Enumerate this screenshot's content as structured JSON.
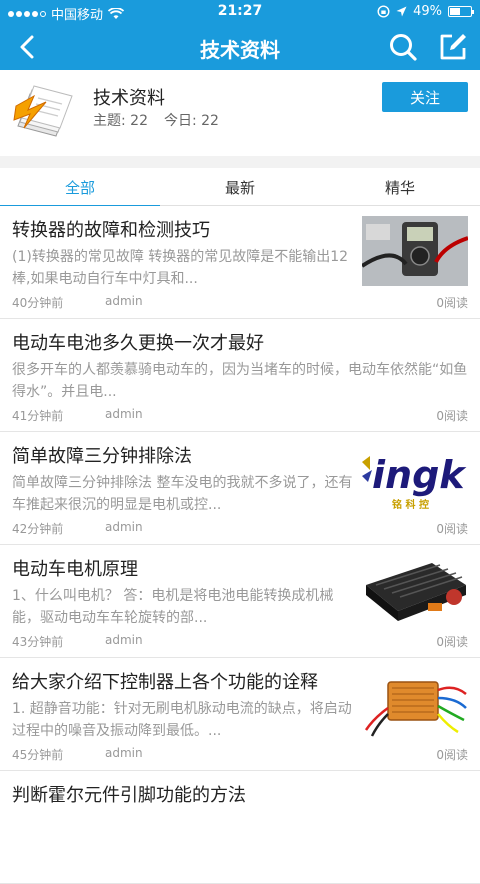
{
  "status": {
    "carrier": "中国移动",
    "time": "21:27",
    "battery": "49%"
  },
  "nav": {
    "title": "技术资料"
  },
  "forum": {
    "name": "技术资料",
    "topics_label": "主题: 22",
    "today_label": "今日: 22",
    "follow_label": "关注"
  },
  "tabs": [
    {
      "label": "全部",
      "active": true
    },
    {
      "label": "最新",
      "active": false
    },
    {
      "label": "精华",
      "active": false
    }
  ],
  "articles": [
    {
      "title": "转换器的故障和检测技巧",
      "summary": "(1)转换器的常见故障 转换器的常见故障是不能输出12棒,如果电动自行车中灯具和...",
      "time": "40分钟前",
      "author": "admin",
      "reads": "0阅读",
      "thumb": "multimeter-photo"
    },
    {
      "title": "电动车电池多久更换一次才最好",
      "summary": "很多开车的人都羡慕骑电动车的，因为当堵车的时候，电动车依然能“如鱼得水”。并且电...",
      "time": "41分钟前",
      "author": "admin",
      "reads": "0阅读",
      "thumb": ""
    },
    {
      "title": "简单故障三分钟排除法",
      "summary": "简单故障三分钟排除法  整车没电的我就不多说了，还有车推起来很沉的明显是电机或控...",
      "time": "42分钟前",
      "author": "admin",
      "reads": "0阅读",
      "thumb": "brand-logo",
      "thumb_text": "ingk",
      "thumb_sub": "铭 科 控"
    },
    {
      "title": "电动车电机原理",
      "summary": "1、什么叫电机？    答：电机是将电池电能转换成机械能，驱动电动车车轮旋转的部...",
      "time": "43分钟前",
      "author": "admin",
      "reads": "0阅读",
      "thumb": "controller-photo"
    },
    {
      "title": "给大家介绍下控制器上各个功能的诠释",
      "summary": "1. 超静音功能：针对无刷电机脉动电流的缺点，将启动过程中的噪音及振动降到最低。...",
      "time": "45分钟前",
      "author": "admin",
      "reads": "0阅读",
      "thumb": "wired-controller-photo"
    },
    {
      "title": "判断霍尔元件引脚功能的方法",
      "summary": "",
      "time": "",
      "author": "",
      "reads": "",
      "thumb": ""
    }
  ]
}
